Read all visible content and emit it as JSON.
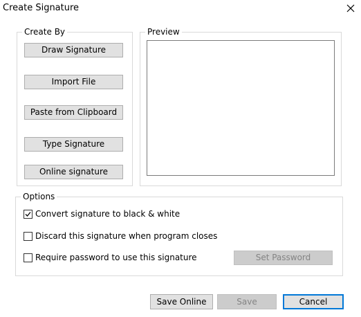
{
  "window": {
    "title": "Create Signature",
    "close_icon": "close-icon"
  },
  "create_by": {
    "legend": "Create By",
    "buttons": [
      "Draw Signature",
      "Import File",
      "Paste from Clipboard",
      "Type Signature",
      "Online signature"
    ]
  },
  "preview": {
    "legend": "Preview"
  },
  "options": {
    "legend": "Options",
    "convert_bw": {
      "label": "Convert signature to black & white",
      "checked": true
    },
    "discard": {
      "label": "Discard this signature when program closes",
      "checked": false
    },
    "require_password": {
      "label": "Require password to use this signature",
      "checked": false
    },
    "set_password_label": "Set Password"
  },
  "footer": {
    "save_online": "Save Online",
    "save": "Save",
    "cancel": "Cancel"
  }
}
